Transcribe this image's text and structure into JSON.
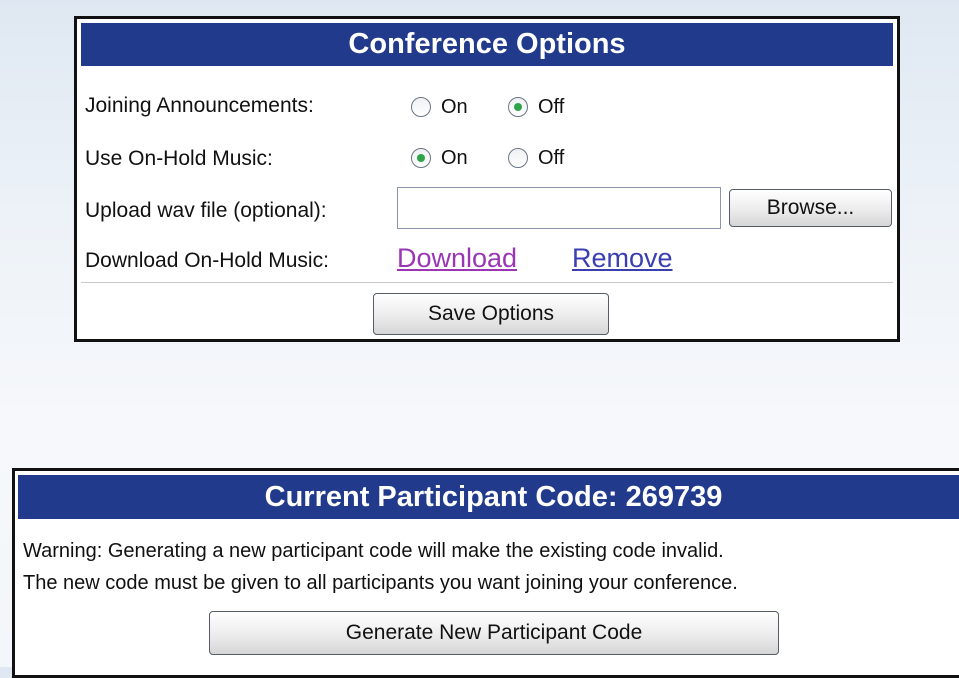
{
  "conference_options": {
    "title": "Conference Options",
    "joining_announcements": {
      "label": "Joining Announcements:",
      "on_label": "On",
      "off_label": "Off",
      "selected": "Off"
    },
    "on_hold_music": {
      "label": "Use On-Hold Music:",
      "on_label": "On",
      "off_label": "Off",
      "selected": "On"
    },
    "upload": {
      "label": "Upload wav file (optional):",
      "value": "",
      "browse_label": "Browse..."
    },
    "download": {
      "label": "Download On-Hold Music:",
      "download_link": "Download",
      "remove_link": "Remove"
    },
    "save_label": "Save Options"
  },
  "participant_code": {
    "title": "Current Participant Code: 269739",
    "warning_line1": "Warning: Generating a new participant code will make the existing code invalid.",
    "warning_line2": "The new code must be given to all participants you want joining your conference.",
    "generate_label": "Generate New Participant Code"
  },
  "colors": {
    "header_bg": "#223a8c",
    "radio_selected": "#2fa34a",
    "download_link": "#9a36b4",
    "remove_link": "#3a3fb0"
  }
}
